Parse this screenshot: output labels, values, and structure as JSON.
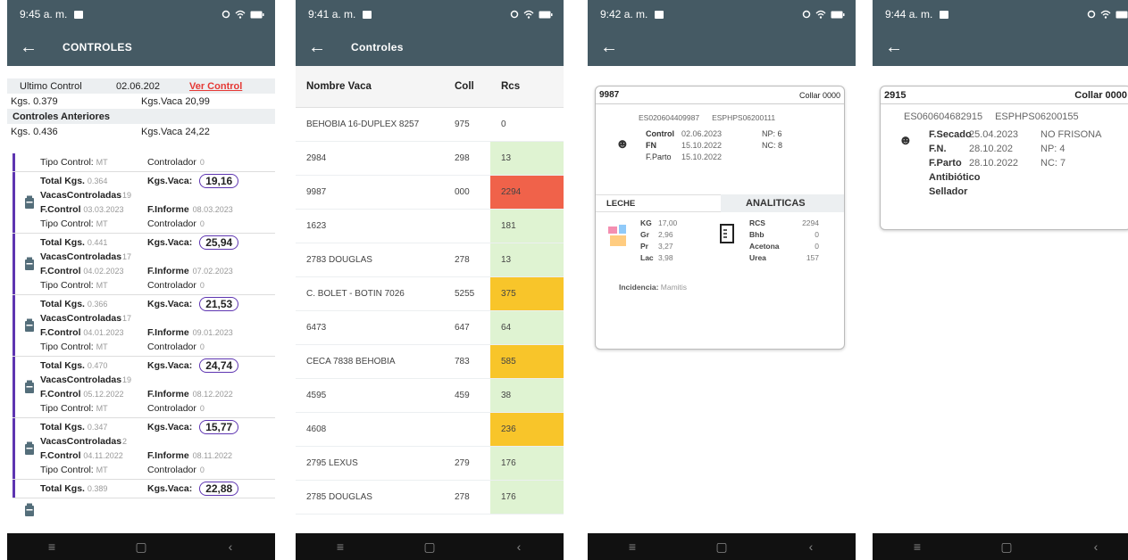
{
  "phone1": {
    "status": {
      "time": "9:45 a. m."
    },
    "appbar": {
      "title": "CONTROLES"
    },
    "summary": {
      "ultimo_label": "Ultimo Control",
      "ultimo_date": "02.06.202",
      "ver_control": "Ver Control",
      "kgs1": "Kgs. 0.379",
      "kgsvaca1": "Kgs.Vaca 20,99",
      "anteriores": "Controles Anteriores",
      "kgs2": "Kgs. 0.436",
      "kgsvaca2": "Kgs.Vaca 24,22"
    },
    "labels": {
      "tipo": "Tipo Control:",
      "controlador": "Controlador",
      "total": "Total Kgs.",
      "kgsvaca": "Kgs.Vaca:",
      "vacas": "VacasControladas",
      "fcontrol": "F.Control",
      "finforme": "F.Informe"
    },
    "first_tipo": {
      "tipo": "MT",
      "controlador": "0"
    },
    "cards": [
      {
        "total": "0.364",
        "kgsvaca": "19,16",
        "vacas": "19",
        "fcontrol": "03.03.2023",
        "finforme": "08.03.2023",
        "tipo": "MT",
        "controlador": "0"
      },
      {
        "total": "0.441",
        "kgsvaca": "25,94",
        "vacas": "17",
        "fcontrol": "04.02.2023",
        "finforme": "07.02.2023",
        "tipo": "MT",
        "controlador": "0"
      },
      {
        "total": "0.366",
        "kgsvaca": "21,53",
        "vacas": "17",
        "fcontrol": "04.01.2023",
        "finforme": "09.01.2023",
        "tipo": "MT",
        "controlador": "0"
      },
      {
        "total": "0.470",
        "kgsvaca": "24,74",
        "vacas": "19",
        "fcontrol": "05.12.2022",
        "finforme": "08.12.2022",
        "tipo": "MT",
        "controlador": "0"
      },
      {
        "total": "0.347",
        "kgsvaca": "15,77",
        "vacas": "2",
        "fcontrol": "04.11.2022",
        "finforme": "08.11.2022",
        "tipo": "MT",
        "controlador": "0"
      },
      {
        "total": "0.389",
        "kgsvaca": "22,88"
      }
    ]
  },
  "phone2": {
    "status": {
      "time": "9:41 a. m."
    },
    "appbar": {
      "title": "Controles"
    },
    "headers": [
      "Nombre Vaca",
      "Coll",
      "Rcs"
    ],
    "rows": [
      {
        "nombre": "BEHOBIA 16-DUPLEX 8257",
        "coll": "975",
        "rcs": "0",
        "color": "white"
      },
      {
        "nombre": "2984",
        "coll": "298",
        "rcs": "13",
        "color": "green"
      },
      {
        "nombre": "9987",
        "coll": "000",
        "rcs": "2294",
        "color": "red"
      },
      {
        "nombre": "1623",
        "coll": "",
        "rcs": "181",
        "color": "green"
      },
      {
        "nombre": "2783 DOUGLAS",
        "coll": "278",
        "rcs": "13",
        "color": "green"
      },
      {
        "nombre": "C. BOLET - BOTIN 7026",
        "coll": "5255",
        "rcs": "375",
        "color": "yellow"
      },
      {
        "nombre": "6473",
        "coll": "647",
        "rcs": "64",
        "color": "green"
      },
      {
        "nombre": "CECA 7838 BEHOBIA",
        "coll": "783",
        "rcs": "585",
        "color": "yellow"
      },
      {
        "nombre": "4595",
        "coll": "459",
        "rcs": "38",
        "color": "green"
      },
      {
        "nombre": "4608",
        "coll": "",
        "rcs": "236",
        "color": "yellow"
      },
      {
        "nombre": "2795 LEXUS",
        "coll": "279",
        "rcs": "176",
        "color": "green"
      },
      {
        "nombre": "2785 DOUGLAS",
        "coll": "278",
        "rcs": "176",
        "color": "green"
      }
    ]
  },
  "phone3": {
    "status": {
      "time": "9:42 a. m."
    },
    "card": {
      "id": "9987",
      "collar": "Collar 0000",
      "code1": "ES020604409987",
      "code2": "ESPHPS06200111",
      "control_k": "Control",
      "control_v": "02.06.2023",
      "fn_k": "FN",
      "fn_v": "15.10.2022",
      "fparto_k": "F.Parto",
      "fparto_v": "15.10.2022",
      "np": "NP: 6",
      "nc": "NC: 8",
      "leche": "LECHE",
      "analiticas": "ANALITICAS",
      "kg_k": "KG",
      "kg_v": "17,00",
      "gr_k": "Gr",
      "gr_v": "2,96",
      "pr_k": "Pr",
      "pr_v": "3,27",
      "lac_k": "Lac",
      "lac_v": "3,98",
      "rcs_k": "RCS",
      "rcs_v": "2294",
      "bhb_k": "Bhb",
      "bhb_v": "0",
      "acetona_k": "Acetona",
      "acetona_v": "0",
      "urea_k": "Urea",
      "urea_v": "157",
      "incid_k": "Incidencia:",
      "incid_v": "Mamitis"
    }
  },
  "phone4": {
    "status": {
      "time": "9:44 a. m."
    },
    "card": {
      "id": "2915",
      "collar": "Collar 0000",
      "code1": "ES060604682915",
      "code2": "ESPHPS06200155",
      "fsecado_k": "F.Secado",
      "fsecado_v": "25.04.2023",
      "fn_k": "F.N.",
      "fn_v": "28.10.202",
      "fparto_k": "F.Parto",
      "fparto_v": "28.10.2022",
      "antibiotico": "Antibiótico",
      "sellador": "Sellador",
      "raza": "NO FRISONA",
      "np": "NP: 4",
      "nc": "NC: 7"
    }
  },
  "nav": {
    "menu": "≡",
    "home": "▢",
    "back": "‹"
  },
  "colors": {
    "appbar": "#455a64",
    "accent": "#5e35b1",
    "red_link": "#e53935",
    "rcs_green": "#dff3d2",
    "rcs_red": "#f0624a",
    "rcs_yellow": "#f8c52a"
  }
}
